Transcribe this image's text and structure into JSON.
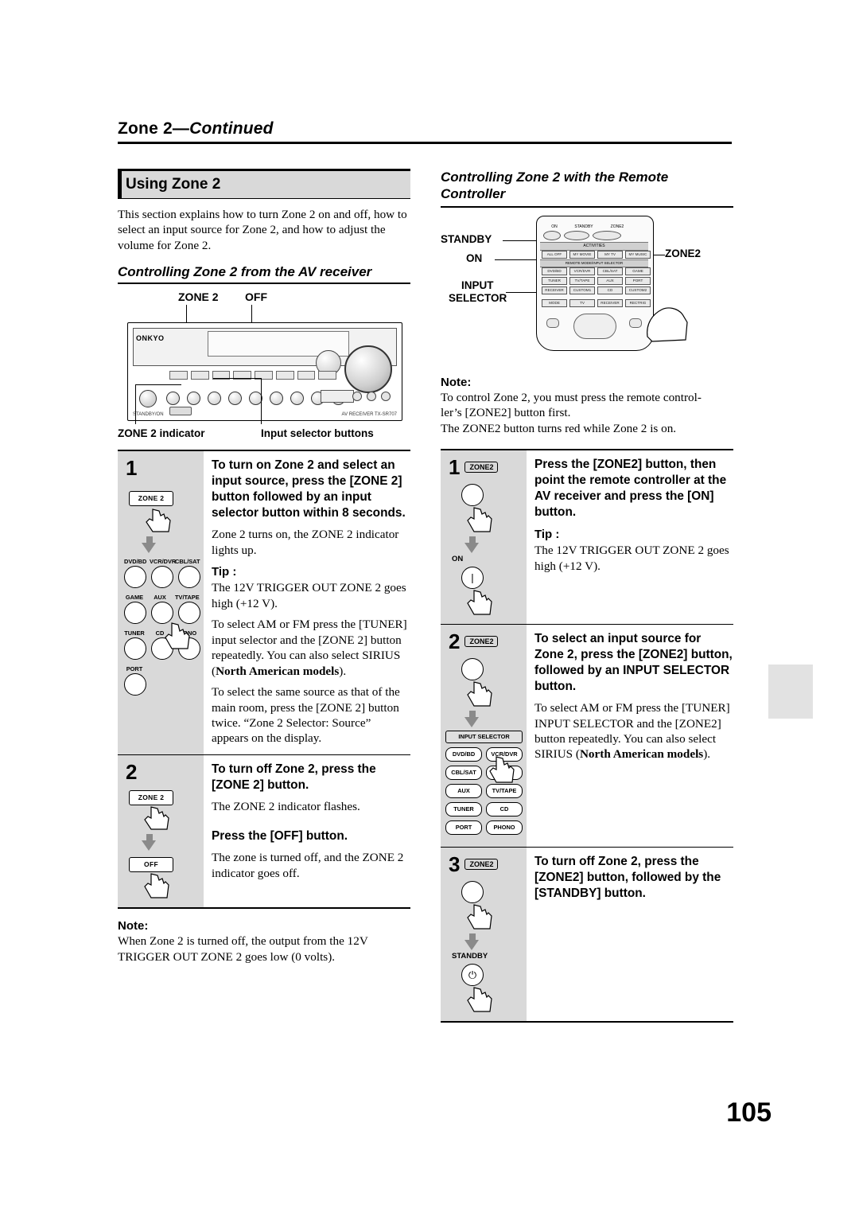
{
  "header": {
    "title_main": "Zone 2",
    "title_dash": "—",
    "title_cont": "Continued"
  },
  "left": {
    "section_title": "Using Zone 2",
    "intro": "This section explains how to turn Zone 2 on and off, how to select an input source for Zone 2, and how to adjust the volume for Zone 2.",
    "sub_head": "Controlling Zone 2 from the AV receiver",
    "figure": {
      "label_zone2": "ZONE 2",
      "label_off": "OFF",
      "caption_indicator": "ZONE 2 indicator",
      "caption_inputsel": "Input selector buttons",
      "brand": "ONKYO",
      "footer_left": "STANDBY/ON",
      "footer_right": "AV RECEIVER TX-SR707"
    },
    "steps": [
      {
        "num": "1",
        "title": "To turn on Zone 2 and select an input source, press the [ZONE 2] button followed by an input selector button within 8 seconds.",
        "body": "Zone 2 turns on, the ZONE 2 indicator lights up.",
        "tip_label": "Tip :",
        "tip_body": "The 12V TRIGGER OUT ZONE 2 goes high (+12 V).",
        "body2_a": "To select AM or FM press the [TUNER] input selector and the [ZONE 2] button repeatedly. You can also select SIRIUS (",
        "body2_bold": "North American models",
        "body2_b": ").",
        "body3": "To select the same source as that of the main room, press the [ZONE 2] button twice. “Zone 2 Selector: Source” appears on the display.",
        "key_label": "ZONE 2",
        "selector_rows": [
          [
            "DVD/BD",
            "VCR/DVR",
            "CBL/SAT"
          ],
          [
            "GAME",
            "AUX",
            "TV/TAPE"
          ],
          [
            "TUNER",
            "CD",
            "PHONO"
          ],
          [
            "PORT"
          ]
        ]
      },
      {
        "num": "2",
        "title": "To turn off Zone 2, press the [ZONE 2] button.",
        "body": "The ZONE 2 indicator flashes.",
        "title2": "Press the [OFF] button.",
        "body2": "The zone is turned off, and the ZONE 2 indicator goes off.",
        "key_label": "ZONE 2",
        "key_label2": "OFF"
      }
    ],
    "note_label": "Note:",
    "note_body": "When Zone 2 is turned off, the output from the 12V TRIGGER OUT ZONE 2 goes low (0 volts)."
  },
  "right": {
    "head": "Controlling Zone 2 with the Remote Controller",
    "figure": {
      "label_standby": "STANDBY",
      "label_on": "ON",
      "label_input": "INPUT",
      "label_selector": "SELECTOR",
      "label_zone2": "ZONE2",
      "remote_row1": [
        "ON",
        "STANDBY",
        "ZONE2"
      ],
      "remote_activities": "ACTIVITIES",
      "remote_row_act": [
        "ALL OFF",
        "MY MOVIE",
        "MY TV",
        "MY MUSIC"
      ],
      "remote_mode_strip": "REMOTE MODE/INPUT SELECTOR",
      "remote_grid": [
        [
          "DVD/BD",
          "VCR/DVR",
          "CBL/SAT",
          "GAME"
        ],
        [
          "TUNER",
          "TV/TAPE",
          "AUX",
          "PORT"
        ],
        [
          "RECEIVER",
          "CUSTOM1",
          "CD",
          "CUSTOM2"
        ],
        [
          "MODE",
          "TV",
          "RECEIVER",
          "RECTRIG"
        ]
      ]
    },
    "note_label": "Note:",
    "note_body": "To control Zone 2, you must press the remote controller’s [ZONE2] button first.\nThe ZONE2 button turns red while Zone 2 is on.",
    "note_line1": "To control Zone 2, you must press the remote control-",
    "note_line2": "ler’s [ZONE2] button first.",
    "note_line3": "The ZONE2 button turns red while Zone 2 is on.",
    "steps": [
      {
        "num": "1",
        "key_label": "ZONE2",
        "sub_label": "ON",
        "title": "Press the [ZONE2] button, then point the remote controller at the AV receiver and press the [ON] button.",
        "tip_label": "Tip :",
        "tip_body": "The 12V TRIGGER OUT ZONE 2 goes high (+12 V)."
      },
      {
        "num": "2",
        "key_label": "ZONE2",
        "panel_header": "INPUT SELECTOR",
        "title": "To select an input source for Zone 2, press the [ZONE2] button, followed by an INPUT SELECTOR button.",
        "body_a": "To select AM or FM press the [TUNER] INPUT SELECTOR and the [ZONE2] button repeatedly. You can also select SIRIUS (",
        "body_bold": "North American models",
        "body_b": ").",
        "selector_rows": [
          [
            "DVD/BD",
            "VCR/DVR"
          ],
          [
            "CBL/SAT",
            "GAME"
          ],
          [
            "AUX",
            "TV/TAPE"
          ],
          [
            "TUNER",
            "CD"
          ],
          [
            "PORT",
            "PHONO"
          ]
        ]
      },
      {
        "num": "3",
        "key_label": "ZONE2",
        "sub_label": "STANDBY",
        "title": "To turn off Zone 2, press the [ZONE2] button, followed by the [STANDBY] button."
      }
    ]
  },
  "footer": {
    "page_number": "105"
  }
}
